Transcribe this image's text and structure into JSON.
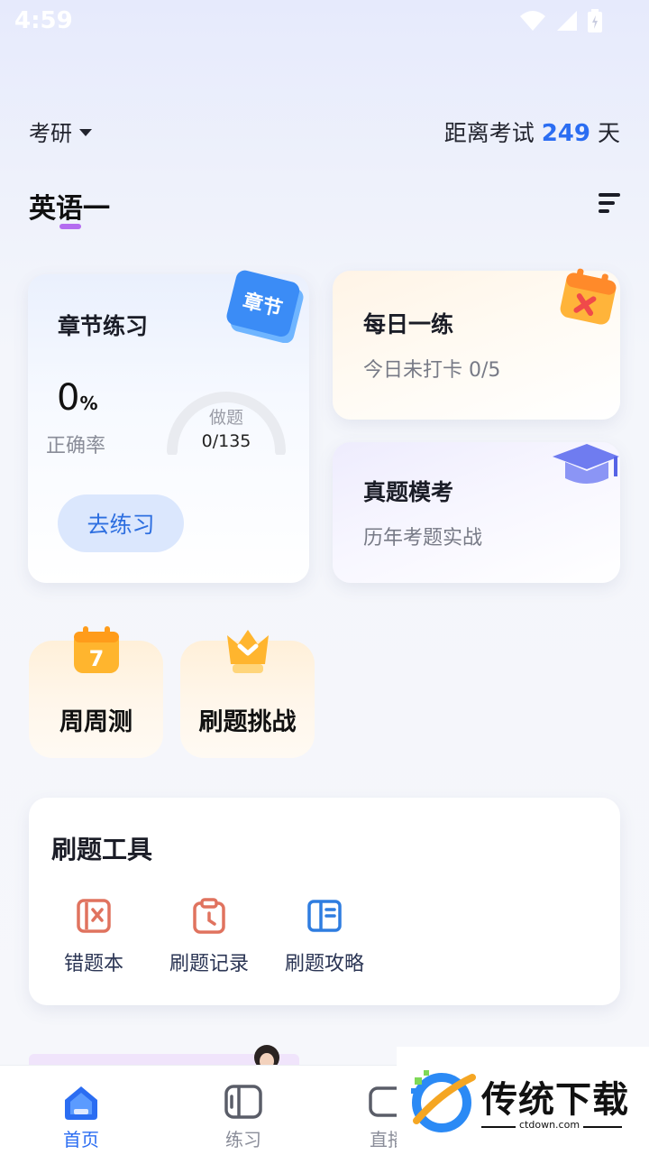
{
  "status_bar": {
    "time": "4:59"
  },
  "header": {
    "exam_type": "考研",
    "countdown_prefix": "距离考试",
    "countdown_days": "249",
    "countdown_suffix": "天"
  },
  "subject": {
    "title": "英语一"
  },
  "chapter_card": {
    "title": "章节练习",
    "badge": "章节",
    "accuracy_value": "0",
    "accuracy_unit": "%",
    "accuracy_label": "正确率",
    "done_label": "做题",
    "done_value": "0/135",
    "done_progress": 0,
    "button": "去练习"
  },
  "daily_card": {
    "title": "每日一练",
    "subtitle": "今日未打卡 0/5"
  },
  "mock_card": {
    "title": "真题模考",
    "subtitle": "历年考题实战"
  },
  "mini_cards": {
    "weekly": {
      "label": "周周测",
      "icon_number": "7"
    },
    "challenge": {
      "label": "刷题挑战"
    }
  },
  "tools": {
    "title": "刷题工具",
    "items": [
      {
        "label": "错题本",
        "icon": "wrong-book-icon"
      },
      {
        "label": "刷题记录",
        "icon": "clipboard-clock-icon"
      },
      {
        "label": "刷题攻略",
        "icon": "book-guide-icon"
      }
    ]
  },
  "tabbar": {
    "items": [
      {
        "label": "首页",
        "icon": "home-icon",
        "active": true
      },
      {
        "label": "练习",
        "icon": "practice-icon",
        "active": false
      },
      {
        "label": "直播",
        "icon": "live-icon",
        "active": false
      }
    ]
  },
  "watermark": {
    "text": "传统下载",
    "url": "ctdown.com"
  },
  "colors": {
    "accent_blue": "#2b6df2",
    "underline_purple": "#b46cf0",
    "tool_red": "#e0735f",
    "tool_blue": "#2f7de0"
  }
}
